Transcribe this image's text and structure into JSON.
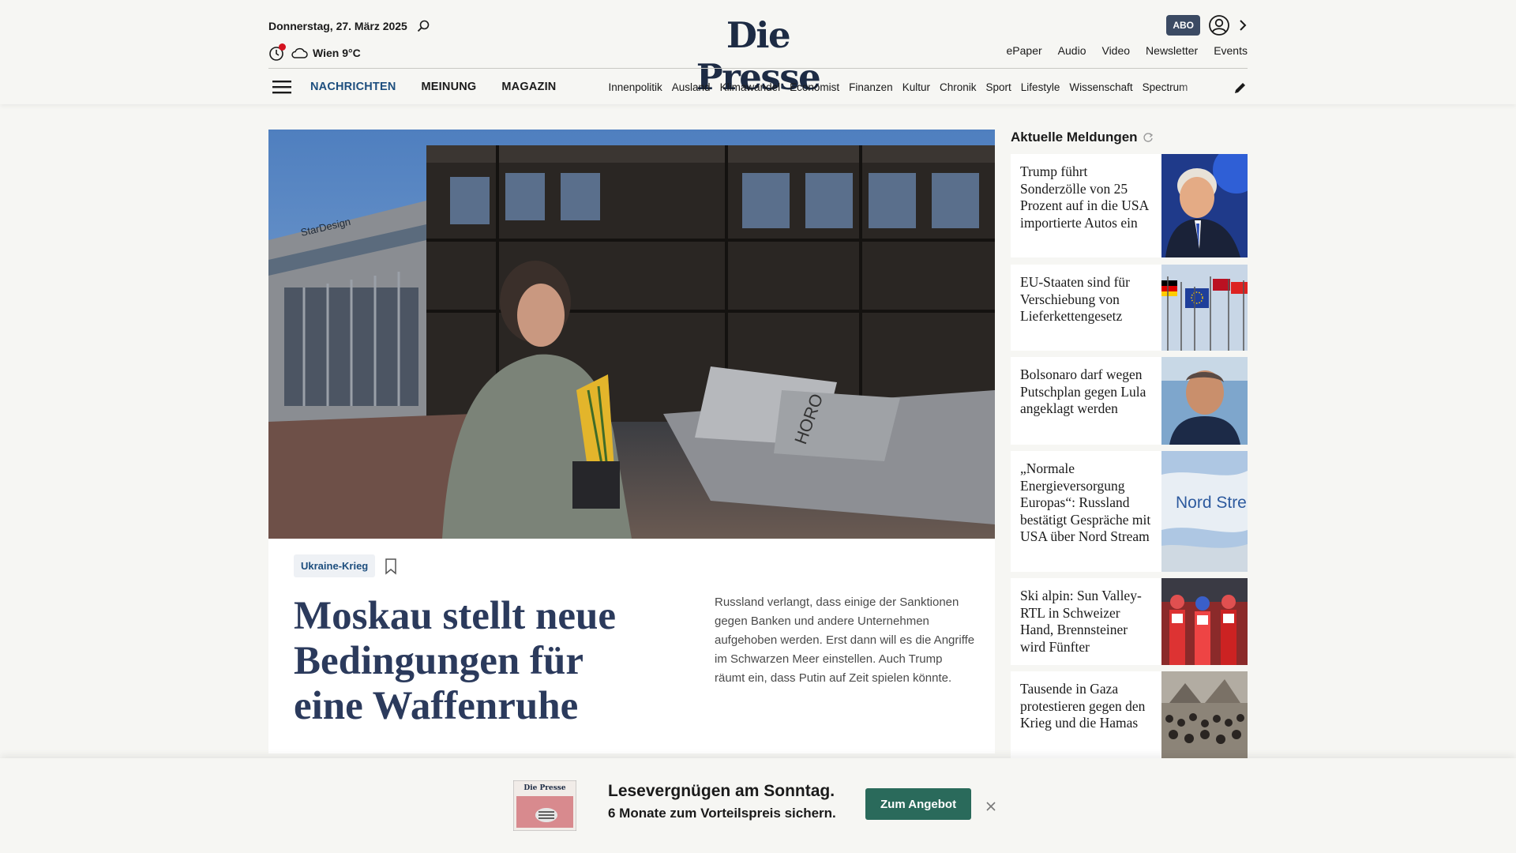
{
  "header": {
    "date": "Donnerstag, 27. März 2025",
    "weather": "Wien 9°C",
    "logo": "Die Presse",
    "abo": "ABO",
    "top_links": [
      "ePaper",
      "Audio",
      "Video",
      "Newsletter",
      "Events"
    ],
    "main_nav": [
      "NACHRICHTEN",
      "MEINUNG",
      "MAGAZIN"
    ],
    "sub_nav": [
      "Innenpolitik",
      "Ausland",
      "Klimawandel",
      "Economist",
      "Finanzen",
      "Kultur",
      "Chronik",
      "Sport",
      "Lifestyle",
      "Wissenschaft",
      "Spectrum"
    ],
    "icons": [
      "search-icon",
      "clock-icon",
      "cloud-icon",
      "user-icon",
      "chevron-right-icon",
      "menu-icon",
      "pen-icon"
    ]
  },
  "hero": {
    "tag": "Ukraine-Krieg",
    "headline": "Moskau stellt neue Bedingungen für eine Waffenruhe",
    "teaser": "Russland verlangt, dass einige der Sanktionen gegen Banken und andere Unternehmen aufgehoben werden. Erst dann will es die Angriffe im Schwarzen Meer einstellen. Auch Trump räumt ein, dass Putin auf Zeit spielen könnte.",
    "image_sign_1": "StarDesign",
    "image_sign_2": "HORO"
  },
  "sidebar": {
    "title": "Aktuelle Meldungen",
    "items": [
      {
        "title": "Trump führt Sonderzölle von 25 Prozent auf in die USA importierte Autos ein"
      },
      {
        "title": "EU-Staaten sind für Verschiebung von Lieferkettengesetz"
      },
      {
        "title": "Bolsonaro darf wegen Putschplan gegen Lula angeklagt werden"
      },
      {
        "title": "„Normale Energieversorgung Europas“: Russland bestätigt Gespräche mit USA über Nord Stream"
      },
      {
        "title": "Ski alpin: Sun Valley-RTL in Schweizer Hand, Brennsteiner wird Fünfter"
      },
      {
        "title": "Tausende in Gaza protestieren gegen den Krieg und die Hamas"
      }
    ],
    "thumb_text_nordstream": "Nord Stre"
  },
  "banner": {
    "title": "Lesevergnügen am Sonntag.",
    "subtitle": "6 Monate zum Vorteilspreis sichern.",
    "cta": "Zum Angebot",
    "epaper_logo": "Die Presse"
  },
  "colors": {
    "background": "#f6f6f3",
    "brand_navy": "#1d2b44",
    "nav_active": "#1d4e7e",
    "headline": "#2b3a5c",
    "cta": "#2a6a5b",
    "abo_badge": "#3b4a63",
    "alert_dot": "#d4121f"
  }
}
